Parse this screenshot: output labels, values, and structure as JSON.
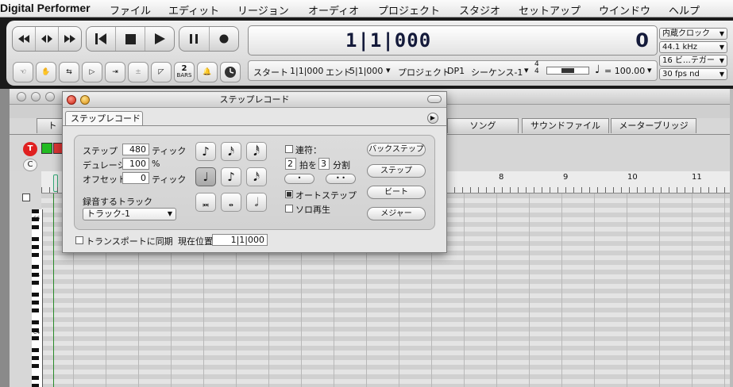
{
  "menubar": {
    "app": "Digital Performer",
    "items": [
      "ファイル",
      "エディット",
      "リージョン",
      "オーディオ",
      "プロジェクト",
      "スタジオ",
      "セットアップ",
      "ウインドウ",
      "ヘルプ"
    ]
  },
  "control_panel": {
    "counter": "1|1|000",
    "seconds": "0",
    "small_buttons": [
      "",
      "",
      "",
      "",
      "",
      "",
      "",
      "2\nBARS",
      "",
      ""
    ],
    "bars_label": "2",
    "bars_sub": "BARS",
    "info": {
      "start_label": "スタート",
      "start_value": "1|1|000",
      "end_label": "エンド",
      "end_value": "5|1|000",
      "project_label": "プロジェクト",
      "project_value": "DP1",
      "sequence": "シーケンス-1",
      "meter_top": "4",
      "meter_bottom": "4",
      "tempo": "= 100.00"
    },
    "dropdowns": [
      "内蔵クロック",
      "44.1 kHz",
      "16 ビ…テガー",
      "30 fps nd"
    ]
  },
  "seq_window": {
    "tabs": [
      "ト",
      "ソング",
      "サウンドファイル",
      "メーターブリッジ"
    ],
    "record_btn": "T",
    "c_btn": "C",
    "ruler_marks": [
      "8",
      "9",
      "10",
      "11"
    ],
    "key_labels": [
      "C6",
      "C5",
      "C4"
    ]
  },
  "step_record": {
    "title": "ステップレコード",
    "tab": "ステップレコード",
    "step_label": "ステップ",
    "step_value": "480",
    "step_unit": "ティック",
    "duration_label": "デュレーシ",
    "duration_value": "100",
    "duration_unit": "%",
    "offset_label": "オフセット",
    "offset_value": "0",
    "offset_unit": "ティック",
    "track_label": "録音するトラック",
    "track_value": "トラック-1",
    "tuplet_label": "連符：",
    "tuplet_a": "2",
    "tuplet_mid": "拍を",
    "tuplet_b": "3",
    "tuplet_end": "分割",
    "autostep_label": "オートステップ",
    "solo_label": "ソロ再生",
    "buttons": [
      "バックステップ",
      "ステップ",
      "ビート",
      "メジャー"
    ],
    "sync_label": "トランスポートに同期",
    "position_label": "現在位置",
    "position_value": "1|1|000",
    "notes": [
      "♪",
      "𝅘𝅥𝅯",
      "𝅘𝅥𝅰",
      "♩",
      "♪",
      "𝅘𝅥𝅯",
      "𝅜",
      "𝅝",
      "𝅗𝅥"
    ],
    "dot_pills": [
      "•",
      "• •"
    ]
  },
  "colors": {
    "menubar": "#eeeeee",
    "control_bg": "#1a1a1a",
    "counter_text": "#141a3a",
    "record_red": "#e02020",
    "play_green": "#22bb22"
  }
}
